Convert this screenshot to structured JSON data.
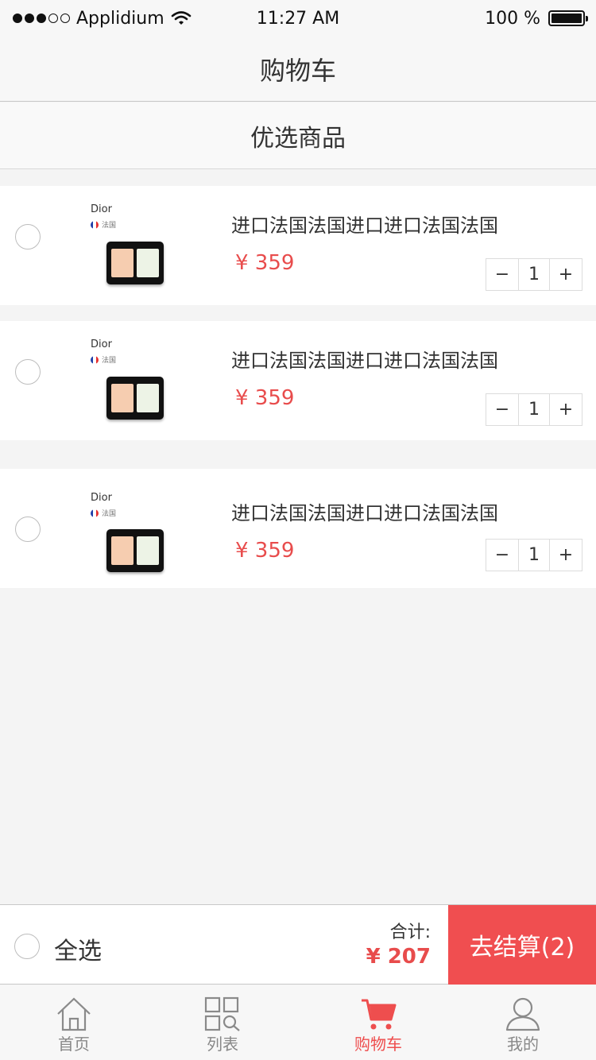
{
  "status_bar": {
    "carrier": "Applidium",
    "time": "11:27 AM",
    "battery": "100 %"
  },
  "nav": {
    "title": "购物车"
  },
  "section": {
    "title": "优选商品"
  },
  "cart_items": [
    {
      "brand": "Dior",
      "origin": "法国",
      "title": "进口法国法国进口进口法国法国",
      "price": "¥ 359",
      "qty": "1",
      "minus": "−",
      "plus": "+"
    },
    {
      "brand": "Dior",
      "origin": "法国",
      "title": "进口法国法国进口进口法国法国",
      "price": "¥ 359",
      "qty": "1",
      "minus": "−",
      "plus": "+"
    },
    {
      "brand": "Dior",
      "origin": "法国",
      "title": "进口法国法国进口进口法国法国",
      "price": "¥ 359",
      "qty": "1",
      "minus": "−",
      "plus": "+"
    }
  ],
  "footer": {
    "select_all": "全选",
    "total_label": "合计:",
    "total_value": "¥ 207",
    "checkout": "去结算(2)"
  },
  "tabs": [
    {
      "label": "首页",
      "icon": "home-icon"
    },
    {
      "label": "列表",
      "icon": "list-grid-icon"
    },
    {
      "label": "购物车",
      "icon": "cart-icon",
      "active": true
    },
    {
      "label": "我的",
      "icon": "user-icon"
    }
  ],
  "colors": {
    "accent": "#ee4e4e",
    "checkout_bg": "#f04e50",
    "page_bg": "#f4f4f4"
  }
}
